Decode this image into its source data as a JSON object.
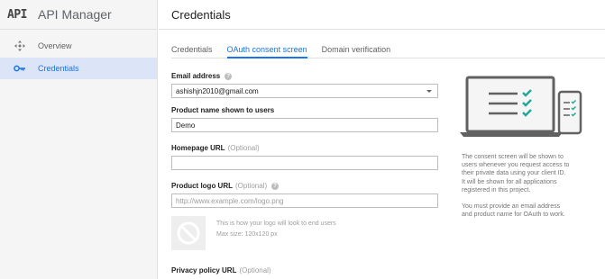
{
  "brand": {
    "logo": "API",
    "name": "API Manager"
  },
  "sidebar": {
    "items": [
      {
        "label": "Overview",
        "icon": "overview-icon",
        "active": false
      },
      {
        "label": "Credentials",
        "icon": "key-icon",
        "active": true
      }
    ]
  },
  "page": {
    "title": "Credentials"
  },
  "tabs": [
    {
      "label": "Credentials",
      "active": false
    },
    {
      "label": "OAuth consent screen",
      "active": true
    },
    {
      "label": "Domain verification",
      "active": false
    }
  ],
  "form": {
    "email": {
      "label": "Email address",
      "value": "ashishjn2010@gmail.com"
    },
    "product_name": {
      "label": "Product name shown to users",
      "value": "Demo"
    },
    "homepage": {
      "label": "Homepage URL",
      "optional": "(Optional)",
      "value": ""
    },
    "logo_url": {
      "label": "Product logo URL",
      "optional": "(Optional)",
      "placeholder": "http://www.example.com/logo.png"
    },
    "logo_note_line1": "This is how your logo will look to end users",
    "logo_note_line2": "Max size: 120x120 px",
    "privacy": {
      "label": "Privacy policy URL",
      "optional": "(Optional)"
    }
  },
  "info": {
    "p1": "The consent screen will be shown to users whenever you request access to their private data using your client ID. It will be shown for all applications registered in this project.",
    "p2": "You must provide an email address and product name for OAuth to work."
  },
  "colors": {
    "accent": "#1a73e8",
    "check": "#26a69a",
    "active_bg": "#dbe5f7"
  }
}
